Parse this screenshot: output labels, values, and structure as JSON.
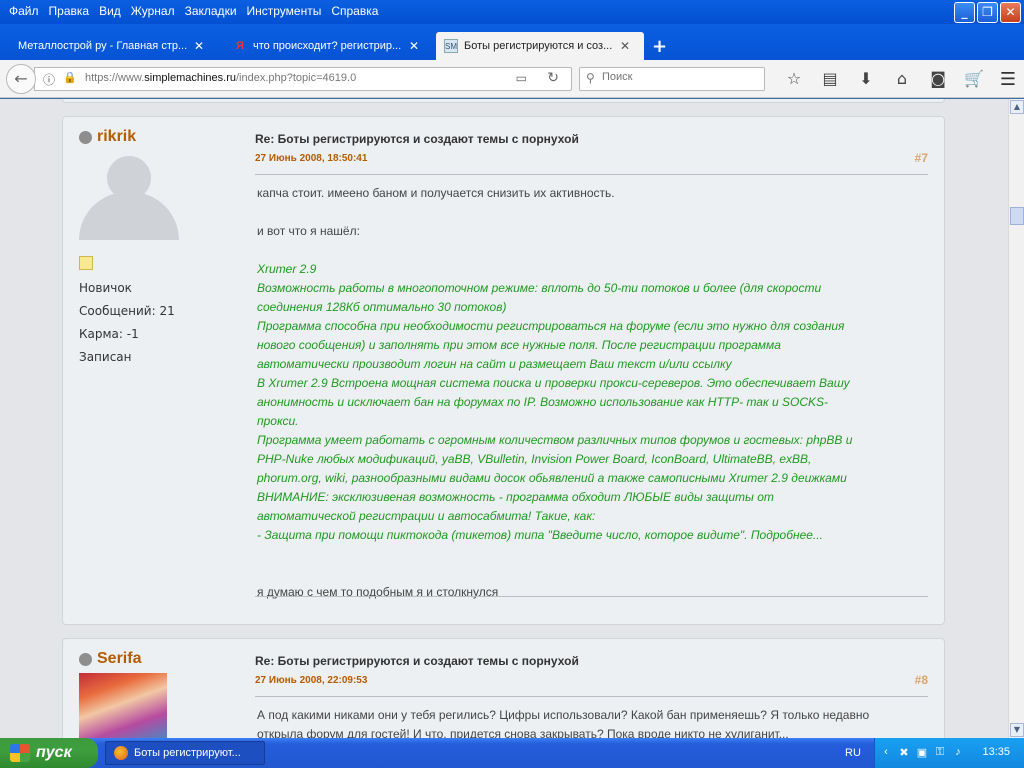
{
  "menubar": {
    "items": [
      "Файл",
      "Правка",
      "Вид",
      "Журнал",
      "Закладки",
      "Инструменты",
      "Справка"
    ]
  },
  "tabs": [
    {
      "title": "Металлострой ру - Главная стр...",
      "favicon": "globe-icon"
    },
    {
      "title": "что происходит? регистрир...",
      "favicon": "yandex-icon"
    },
    {
      "title": "Боты регистрируются и соз...",
      "favicon": "smf-icon"
    }
  ],
  "navbar": {
    "url_prefix": "https://www.",
    "url_domain": "simplemachines.ru",
    "url_path": "/index.php?topic=4619.0",
    "search_placeholder": "Поиск"
  },
  "posts": [
    {
      "username": "rikrik",
      "rank": "Новичок",
      "messages": "Сообщений: 21",
      "karma": "Карма: -1",
      "status": "Записан",
      "subject": "Re: Боты регистрируются и создают темы с порнухой",
      "date": "27 Июнь 2008, 18:50:41",
      "number": "#7",
      "line1": "капча стоит. имеено баном и получается снизить их активность.",
      "line2": "и вот что я нашёл:",
      "quote": [
        "Xrumer 2.9",
        "Возможность работы в многопоточном режиме: вплоть до 50-ти потоков и более (для скорости",
        "соединения 128Кб оптимально 30 потоков)",
        "Программа способна при необходимости регистрироваться на форуме (если это нужно для создания",
        "нового сообщения) и заполнять при этом все нужные поля. После регистрации программа",
        "автоматически производит логин на сайт и размещает Ваш текст и/или ссылку",
        "В Xrumer 2.9 Встроена мощная система поиска и проверки прокси-сереверов. Это обеспечивает Вашу",
        "анонимность и исключает бан на форумах по IP. Возможно использование как HTTP- так и SOCKS-",
        "прокси.",
        "Программа умеет работать с огромным количеством различных типов форумов и гостевых: phpBB и",
        "PHP-Nuke любых модификаций, yaBB, VBulletin, Invision Power Board, IconBoard, UltimateBB, exBB,",
        "phorum.org, wiki, разнообразными видами досок обьявлений а также самописными Xrumer 2.9 деижками",
        "ВНИМАНИЕ: эксклюзивеная возможность - программа обходит ЛЮБЫЕ виды защиты от",
        "автоматической регистрации и автосабмита! Такие, как:",
        "- Защита при помощи пиктокода (тикетов) типа \"Введите число, которое видите\". Подробнее..."
      ],
      "line3": "я думаю с чем то подобным я и столкнулся"
    },
    {
      "username": "Serifa",
      "subject": "Re: Боты регистрируются и создают темы с порнухой",
      "date": "27 Июнь 2008, 22:09:53",
      "number": "#8",
      "line1": "А под какими никами они у тебя регились? Цифры использовали? Какой бан применяешь? Я только недавно",
      "line2": "открыла форум для гостей! И что, придется снова закрывать? Пока вроде никто не хулиганит..."
    }
  ],
  "taskbar": {
    "start_label": "пуск",
    "task_label": "Боты регистрируют...",
    "lang": "RU",
    "clock": "13:35"
  }
}
